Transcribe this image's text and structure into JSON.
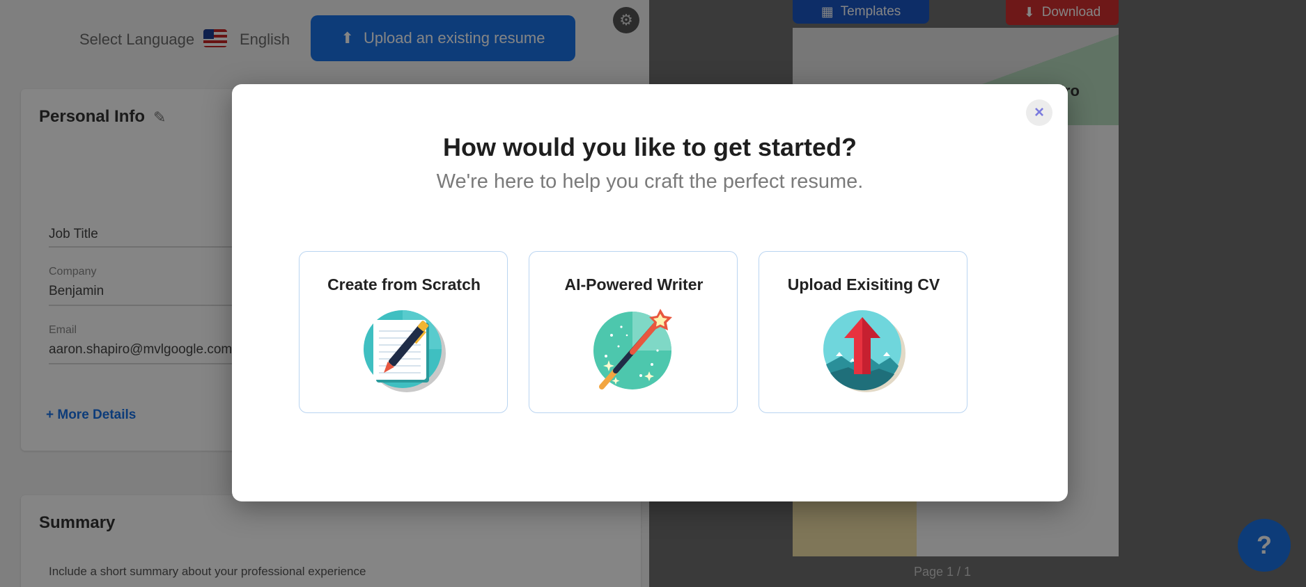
{
  "editor": {
    "language_label": "Select Language",
    "language_value": "English",
    "upload_button": "Upload an existing resume",
    "personal_info": {
      "title": "Personal Info",
      "fields": [
        {
          "label": "",
          "value": "Job Title"
        },
        {
          "label": "Company",
          "value": "Benjamin"
        },
        {
          "label": "Email",
          "value": "aaron.shapiro@mvlgoogle.com"
        }
      ],
      "more_details": "+ More Details"
    },
    "summary": {
      "title": "Summary",
      "hint": "Include a short summary about your professional experience"
    }
  },
  "preview": {
    "templates_button": "Templates",
    "download_button": "Download",
    "resume_name": "Shapiro",
    "page_indicator": "Page 1 / 1",
    "help_label": "?"
  },
  "modal": {
    "close_label": "×",
    "title": "How would you like to get started?",
    "subtitle": "We're here to help you craft the perfect resume.",
    "options": [
      {
        "label": "Create from Scratch",
        "icon": "pen-notebook-icon"
      },
      {
        "label": "AI-Powered Writer",
        "icon": "magic-wand-icon"
      },
      {
        "label": "Upload Exisiting CV",
        "icon": "upload-arrow-icon"
      }
    ]
  },
  "colors": {
    "accent": "#1a73e8",
    "download": "#d32f2f",
    "card_border": "#b9d4f1",
    "close_icon": "#7b7bde",
    "icon_teal": "#3fbfc1"
  }
}
